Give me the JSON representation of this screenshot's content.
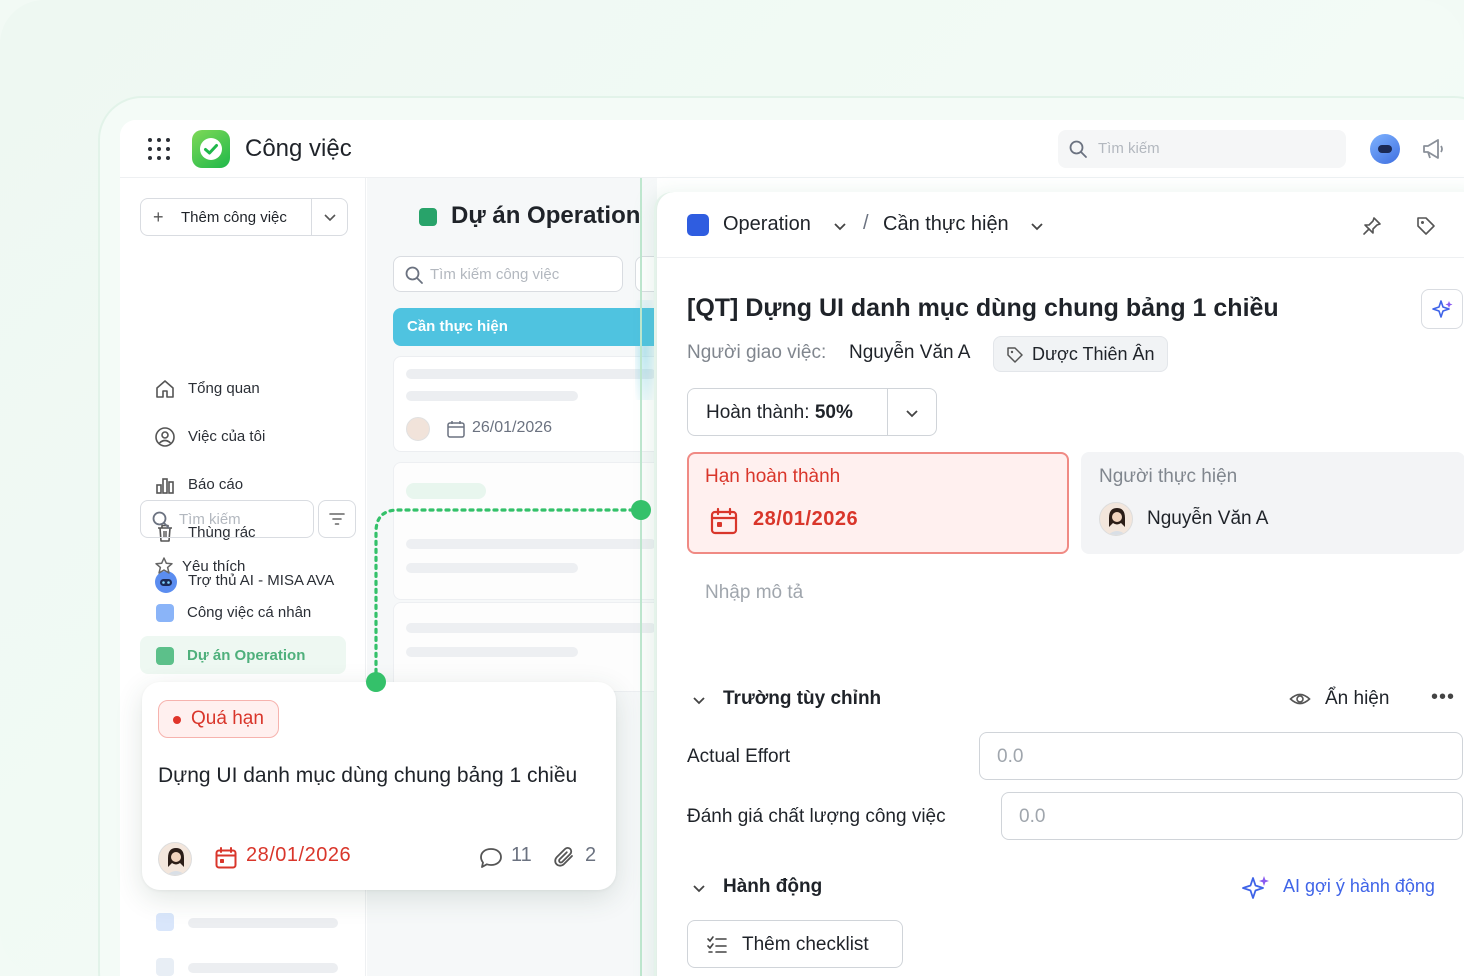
{
  "app": {
    "title": "Công việc"
  },
  "topbar": {
    "search_placeholder": "Tìm kiếm"
  },
  "sidebar": {
    "add_task_label": "Thêm công việc",
    "nav": [
      {
        "label": "Tổng quan",
        "icon": "home-icon"
      },
      {
        "label": "Việc của tôi",
        "icon": "user-circle-icon"
      },
      {
        "label": "Báo cáo",
        "icon": "chart-bar-icon"
      },
      {
        "label": "Thùng rác",
        "icon": "trash-icon"
      },
      {
        "label": "Trợ thủ AI - MISA AVA",
        "icon": "ai-assistant-icon"
      }
    ],
    "search_placeholder": "Tìm kiếm",
    "favorites_label": "Yêu thích",
    "projects": [
      {
        "label": "Công việc cá nhân",
        "color": "#8ab4f8"
      },
      {
        "label": "Dự án Operation",
        "color": "#5cc08a"
      }
    ]
  },
  "middle": {
    "project_title": "Dự án Operation",
    "search_placeholder": "Tìm kiếm công việc",
    "column_label": "Cần thực hiện",
    "card_date": "26/01/2026"
  },
  "detail": {
    "project": "Operation",
    "status": "Cần thực hiện",
    "task_title": "[QT] Dựng UI danh mục dùng chung bảng 1 chiều",
    "assigner_label": "Người giao việc:",
    "assigner_name": "Nguyễn Văn A",
    "tag": "Dược Thiên Ân",
    "progress_label": "Hoàn thành:",
    "progress_value": "50%",
    "deadline_label": "Hạn hoàn thành",
    "deadline_value": "28/01/2026",
    "assignee_label": "Người thực hiện",
    "assignee_name": "Nguyễn Văn A",
    "description_placeholder": "Nhập mô tả",
    "custom_fields_title": "Trường tùy chỉnh",
    "toggle_visibility": "Ẩn hiện",
    "fields": [
      {
        "label": "Actual Effort",
        "value": "0.0"
      },
      {
        "label": "Đánh giá chất lượng công việc",
        "value": "0.0"
      }
    ],
    "actions_title": "Hành động",
    "ai_suggest": "AI gợi ý hành động",
    "checklist_btn": "Thêm checklist"
  },
  "float_card": {
    "badge": "Quá hạn",
    "title": "Dựng UI danh mục dùng chung bảng 1 chiều",
    "date": "28/01/2026",
    "comments": "11",
    "attachments": "2"
  },
  "colors": {
    "accent_green": "#28a36a",
    "column_blue": "#4fc3e0",
    "danger": "#d9362b",
    "ai_blue": "#3f64e8",
    "project_blue": "#2f5de0"
  }
}
